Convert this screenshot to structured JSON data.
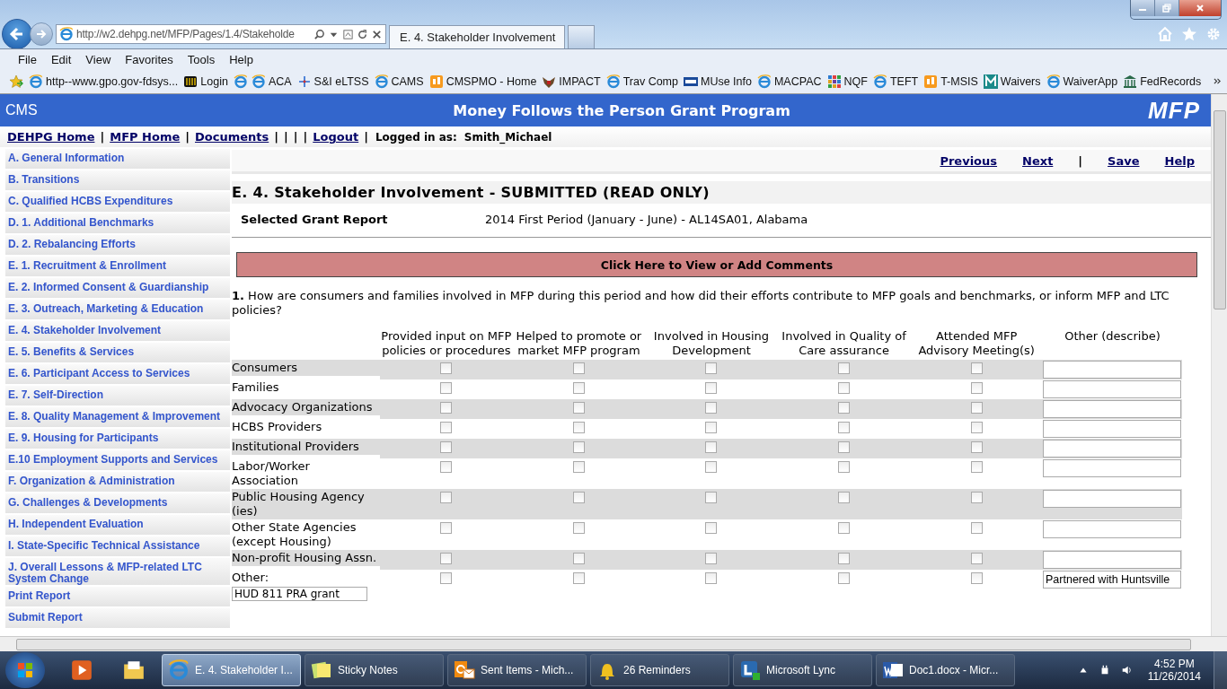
{
  "browser": {
    "address": "http://w2.dehpg.net/MFP/Pages/1.4/Stakeholde",
    "tab_title": "E. 4. Stakeholder Involvement",
    "menu": [
      "File",
      "Edit",
      "View",
      "Favorites",
      "Tools",
      "Help"
    ],
    "bookmarks": [
      {
        "label": "http--www.gpo.gov-fdsys...",
        "kind": "ie"
      },
      {
        "label": "Login",
        "kind": "grid"
      },
      {
        "kind": "ie"
      },
      {
        "label": "ACA",
        "kind": "ie"
      },
      {
        "label": "S&I eLTSS",
        "kind": "arrows"
      },
      {
        "label": "CAMS",
        "kind": "ie"
      },
      {
        "label": "CMSPMO - Home",
        "kind": "orange"
      },
      {
        "label": "IMPACT",
        "kind": "seal"
      },
      {
        "label": "Trav Comp",
        "kind": "ie"
      },
      {
        "label": "MUse Info",
        "kind": "cdc"
      },
      {
        "label": "MACPAC",
        "kind": "ie"
      },
      {
        "label": "NQF",
        "kind": "mosaic"
      },
      {
        "label": "TEFT",
        "kind": "ie"
      },
      {
        "label": "T-MSIS",
        "kind": "orange"
      },
      {
        "label": "Waivers",
        "kind": "m"
      },
      {
        "label": "WaiverApp",
        "kind": "ie"
      },
      {
        "label": "FedRecords",
        "kind": "building"
      }
    ]
  },
  "header": {
    "logo": "CMS",
    "title": "Money Follows the Person Grant Program",
    "brand": "MFP"
  },
  "nav": {
    "items": [
      {
        "kind": "link",
        "label": "DEHPG Home"
      },
      {
        "kind": "separator",
        "label": "|"
      },
      {
        "kind": "link",
        "label": "MFP Home"
      },
      {
        "kind": "separator",
        "label": "|"
      },
      {
        "kind": "link",
        "label": "Documents"
      },
      {
        "kind": "separator",
        "label": "|"
      },
      {
        "kind": "separator",
        "label": "|"
      },
      {
        "kind": "separator",
        "label": "|"
      },
      {
        "kind": "separator",
        "label": "|"
      },
      {
        "kind": "link",
        "label": "Logout"
      },
      {
        "kind": "separator",
        "label": "|"
      }
    ],
    "logged_in_label": "Logged in as:",
    "user": "Smith_Michael"
  },
  "sidebar": {
    "items": [
      "A. General Information",
      "B. Transitions",
      "C. Qualified HCBS Expenditures",
      "D. 1. Additional Benchmarks",
      "D. 2. Rebalancing Efforts",
      "E. 1. Recruitment & Enrollment",
      "E. 2. Informed Consent & Guardianship",
      "E. 3. Outreach, Marketing & Education",
      "E. 4. Stakeholder Involvement",
      "E. 5. Benefits & Services",
      "E. 6. Participant Access to Services",
      "E. 7. Self-Direction",
      "E. 8. Quality Management & Improvement",
      "E. 9. Housing for Participants",
      "E.10 Employment Supports and Services",
      "F. Organization & Administration",
      "G. Challenges & Developments",
      "H. Independent Evaluation",
      "I. State-Specific Technical Assistance",
      "J. Overall Lessons & MFP-related LTC System Change",
      "Print Report",
      "Submit Report"
    ]
  },
  "toolbar": {
    "links": [
      "Previous",
      "Next",
      "Save",
      "Help"
    ],
    "separator": "|"
  },
  "page_title": "E. 4. Stakeholder Involvement - SUBMITTED (READ ONLY)",
  "report": {
    "label": "Selected Grant Report",
    "value": "2014 First Period (January - June) - AL14SA01, Alabama"
  },
  "comments_button": "Click Here to View or Add Comments",
  "question": {
    "number": "1.",
    "text": "How are consumers and families involved in MFP during this period and how did their efforts contribute to MFP goals and benchmarks, or inform MFP and LTC policies?"
  },
  "table": {
    "columns": [
      "Provided input on MFP policies or procedures",
      "Helped to promote or market MFP program",
      "Involved in Housing Development",
      "Involved in Quality of Care assurance",
      "Attended MFP Advisory Meeting(s)",
      "Other (describe)"
    ],
    "rows": [
      {
        "label": "Consumers",
        "cells": [
          {
            "checked": false
          },
          {
            "checked": false
          },
          {
            "checked": false
          },
          {
            "checked": false
          },
          {
            "checked": false
          }
        ]
      },
      {
        "label": "Families",
        "cells": [
          {
            "checked": false
          },
          {
            "checked": false
          },
          {
            "checked": false
          },
          {
            "checked": false
          },
          {
            "checked": false
          }
        ]
      },
      {
        "label": "Advocacy Organizations",
        "cells": [
          {
            "checked": false
          },
          {
            "checked": false
          },
          {
            "checked": false
          },
          {
            "checked": false
          },
          {
            "checked": false
          }
        ]
      },
      {
        "label": "HCBS Providers",
        "cells": [
          {
            "checked": false
          },
          {
            "checked": false
          },
          {
            "checked": false
          },
          {
            "checked": false
          },
          {
            "checked": false
          }
        ]
      },
      {
        "label": "Institutional Providers",
        "cells": [
          {
            "checked": false
          },
          {
            "checked": false
          },
          {
            "checked": false
          },
          {
            "checked": false
          },
          {
            "checked": false
          }
        ]
      },
      {
        "label": "Labor/Worker Association",
        "cells": [
          {
            "checked": false
          },
          {
            "checked": false
          },
          {
            "checked": false
          },
          {
            "checked": false
          },
          {
            "checked": false
          }
        ]
      },
      {
        "label": "Public Housing Agency (ies)",
        "cells": [
          {
            "checked": false
          },
          {
            "checked": false
          },
          {
            "checked": false
          },
          {
            "checked": false
          },
          {
            "checked": false
          }
        ]
      },
      {
        "label": "Other State Agencies (except Housing)",
        "cells": [
          {
            "checked": false
          },
          {
            "checked": false
          },
          {
            "checked": false
          },
          {
            "checked": false
          },
          {
            "checked": false
          }
        ]
      },
      {
        "label": "Non-profit Housing Assn.",
        "cells": [
          {
            "checked": false
          },
          {
            "checked": false
          },
          {
            "checked": false
          },
          {
            "checked": false
          },
          {
            "checked": false
          }
        ]
      },
      {
        "label": "Other:",
        "detail": "HUD 811 PRA grant",
        "other": "Partnered with Huntsville",
        "cells": [
          {
            "checked": false
          },
          {
            "checked": false
          },
          {
            "checked": false
          },
          {
            "checked": false
          },
          {
            "checked": false
          }
        ]
      }
    ]
  },
  "taskbar": {
    "items": [
      {
        "label": "E. 4. Stakeholder I...",
        "kind": "ie",
        "selected": true
      },
      {
        "label": "Sticky Notes",
        "kind": "notes",
        "selected": false
      },
      {
        "label": "Sent Items - Mich...",
        "kind": "outlook",
        "selected": false
      },
      {
        "label": "26 Reminders",
        "kind": "bell",
        "selected": false
      },
      {
        "label": "Microsoft Lync",
        "kind": "lync",
        "selected": false
      },
      {
        "label": "Doc1.docx - Micr...",
        "kind": "word",
        "selected": false
      }
    ],
    "time": "4:52 PM",
    "date": "11/26/2014"
  }
}
